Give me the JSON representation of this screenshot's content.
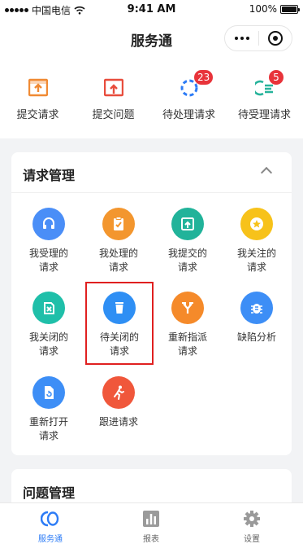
{
  "status": {
    "carrier": "中国电信",
    "time": "9:41 AM",
    "battery": "100%"
  },
  "navbar": {
    "title": "服务通"
  },
  "quick_actions": [
    {
      "label": "提交请求",
      "icon": "upload-box-icon",
      "color": "#f08a34"
    },
    {
      "label": "提交问题",
      "icon": "upload-box-icon",
      "color": "#e84d3d"
    },
    {
      "label": "待处理请求",
      "icon": "loading-circle-icon",
      "color": "#2d7cf6",
      "badge": "23"
    },
    {
      "label": "待受理请求",
      "icon": "list-icon",
      "color": "#27b39b",
      "badge": "5"
    }
  ],
  "request_card": {
    "title": "请求管理",
    "items": [
      {
        "label": "我受理的\n请求",
        "icon": "headset-icon",
        "color": "#4a8ef7"
      },
      {
        "label": "我处理的\n请求",
        "icon": "clipboard-check-icon",
        "color": "#f3962e"
      },
      {
        "label": "我提交的\n请求",
        "icon": "upload-box-icon",
        "color": "#21b39a"
      },
      {
        "label": "我关注的\n请求",
        "icon": "star-icon",
        "color": "#f7c21a"
      },
      {
        "label": "我关闭的\n请求",
        "icon": "delete-icon",
        "color": "#1fbfa9"
      },
      {
        "label": "待关闭的\n请求",
        "icon": "trash-icon",
        "color": "#2f8ff4"
      },
      {
        "label": "重新指派\n请求",
        "icon": "fork-icon",
        "color": "#f58a2a"
      },
      {
        "label": "缺陷分析",
        "icon": "bug-icon",
        "color": "#3d8ef6"
      },
      {
        "label": "重新打开\n请求",
        "icon": "reopen-file-icon",
        "color": "#3d8ef6"
      },
      {
        "label": "跟进请求",
        "icon": "runner-icon",
        "color": "#f0573b"
      }
    ]
  },
  "problem_card": {
    "title": "问题管理"
  },
  "tabbar": [
    {
      "label": "服务通",
      "active": true
    },
    {
      "label": "报表",
      "active": false
    },
    {
      "label": "设置",
      "active": false
    }
  ]
}
